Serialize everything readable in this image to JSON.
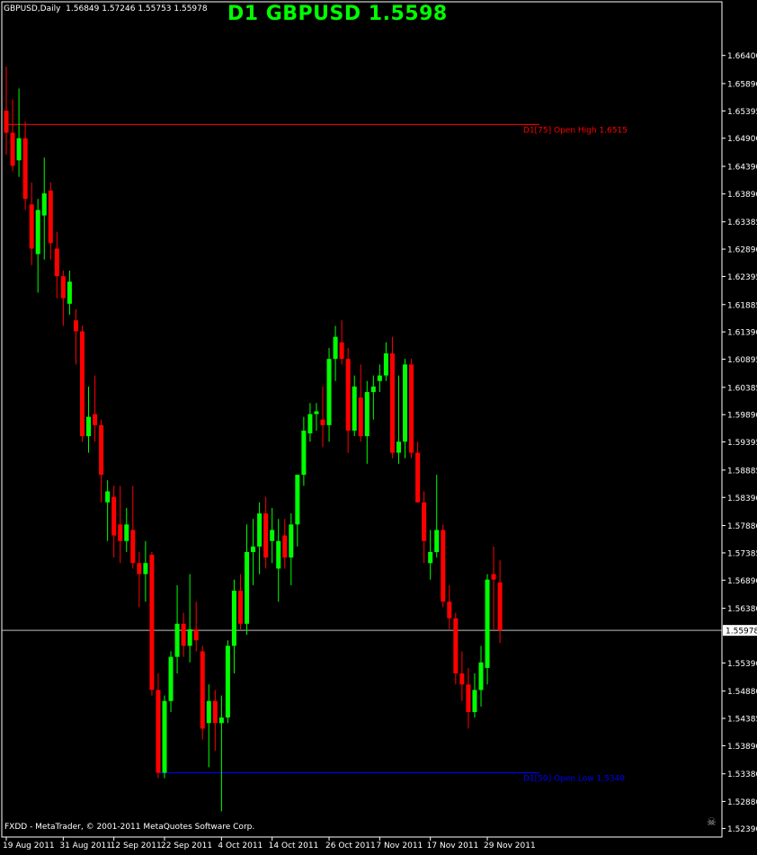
{
  "header": {
    "info": "GBPUSD,Daily  1.56849 1.57246 1.55753 1.55978",
    "title": "D1 GBPUSD 1.5598"
  },
  "footer": {
    "copyright": "FXDD - MetaTrader, © 2001-2011 MetaQuotes Software Corp."
  },
  "colors": {
    "bull": "#00ff00",
    "bear": "#ff0000",
    "grid": "#ffffff",
    "high_line": "#ff0000",
    "low_line": "#0000ff"
  },
  "icons": {
    "corner": "skull-icon"
  },
  "chart_data": {
    "type": "candlestick",
    "symbol": "GBPUSD",
    "timeframe": "Daily",
    "ylim": [
      1.523,
      1.669
    ],
    "price_ticks": [
      "1.66400",
      "1.65890",
      "1.65395",
      "1.64900",
      "1.64390",
      "1.63890",
      "1.63385",
      "1.62890",
      "1.62395",
      "1.61885",
      "1.61390",
      "1.60895",
      "1.60385",
      "1.59890",
      "1.59395",
      "1.58885",
      "1.58390",
      "1.57880",
      "1.57385",
      "1.56890",
      "1.56380",
      "1.55978",
      "1.55390",
      "1.54880",
      "1.54385",
      "1.53890",
      "1.53380",
      "1.52880",
      "1.52390"
    ],
    "date_ticks": [
      {
        "label": "19 Aug 2011",
        "index": 0
      },
      {
        "label": "31 Aug 2011",
        "index": 9
      },
      {
        "label": "12 Sep 2011",
        "index": 17
      },
      {
        "label": "22 Sep 2011",
        "index": 25
      },
      {
        "label": "4 Oct 2011",
        "index": 34
      },
      {
        "label": "14 Oct 2011",
        "index": 42
      },
      {
        "label": "26 Oct 2011",
        "index": 51
      },
      {
        "label": "7 Nov 2011",
        "index": 59
      },
      {
        "label": "17 Nov 2011",
        "index": 67
      },
      {
        "label": "29 Nov 2011",
        "index": 76
      }
    ],
    "current_price": {
      "value": 1.5598,
      "label": "1.55978"
    },
    "levels": [
      {
        "name": "open-high",
        "value": 1.6515,
        "label": "D1[75] Open High 1.6515",
        "color": "#ff0000"
      },
      {
        "name": "open-low",
        "value": 1.534,
        "label": "D1[50] Open Low 1.5340",
        "color": "#0000ff"
      }
    ],
    "candles": [
      {
        "o": 1.654,
        "h": 1.662,
        "l": 1.646,
        "c": 1.65
      },
      {
        "o": 1.65,
        "h": 1.656,
        "l": 1.643,
        "c": 1.644
      },
      {
        "o": 1.645,
        "h": 1.658,
        "l": 1.642,
        "c": 1.649
      },
      {
        "o": 1.649,
        "h": 1.652,
        "l": 1.636,
        "c": 1.638
      },
      {
        "o": 1.637,
        "h": 1.641,
        "l": 1.626,
        "c": 1.629
      },
      {
        "o": 1.628,
        "h": 1.638,
        "l": 1.621,
        "c": 1.636
      },
      {
        "o": 1.635,
        "h": 1.6455,
        "l": 1.627,
        "c": 1.639
      },
      {
        "o": 1.6395,
        "h": 1.641,
        "l": 1.627,
        "c": 1.63
      },
      {
        "o": 1.629,
        "h": 1.632,
        "l": 1.62,
        "c": 1.624
      },
      {
        "o": 1.624,
        "h": 1.625,
        "l": 1.615,
        "c": 1.62
      },
      {
        "o": 1.619,
        "h": 1.625,
        "l": 1.617,
        "c": 1.623
      },
      {
        "o": 1.616,
        "h": 1.618,
        "l": 1.608,
        "c": 1.614
      },
      {
        "o": 1.614,
        "h": 1.615,
        "l": 1.594,
        "c": 1.595
      },
      {
        "o": 1.595,
        "h": 1.604,
        "l": 1.592,
        "c": 1.5985
      },
      {
        "o": 1.599,
        "h": 1.606,
        "l": 1.594,
        "c": 1.597
      },
      {
        "o": 1.597,
        "h": 1.598,
        "l": 1.583,
        "c": 1.588
      },
      {
        "o": 1.583,
        "h": 1.587,
        "l": 1.576,
        "c": 1.585
      },
      {
        "o": 1.584,
        "h": 1.586,
        "l": 1.573,
        "c": 1.577
      },
      {
        "o": 1.579,
        "h": 1.586,
        "l": 1.572,
        "c": 1.576
      },
      {
        "o": 1.576,
        "h": 1.582,
        "l": 1.574,
        "c": 1.579
      },
      {
        "o": 1.578,
        "h": 1.586,
        "l": 1.571,
        "c": 1.572
      },
      {
        "o": 1.572,
        "h": 1.574,
        "l": 1.564,
        "c": 1.57
      },
      {
        "o": 1.57,
        "h": 1.576,
        "l": 1.565,
        "c": 1.572
      },
      {
        "o": 1.5735,
        "h": 1.574,
        "l": 1.548,
        "c": 1.549
      },
      {
        "o": 1.549,
        "h": 1.552,
        "l": 1.533,
        "c": 1.534
      },
      {
        "o": 1.534,
        "h": 1.548,
        "l": 1.533,
        "c": 1.547
      },
      {
        "o": 1.547,
        "h": 1.556,
        "l": 1.545,
        "c": 1.555
      },
      {
        "o": 1.555,
        "h": 1.568,
        "l": 1.552,
        "c": 1.561
      },
      {
        "o": 1.561,
        "h": 1.563,
        "l": 1.555,
        "c": 1.557
      },
      {
        "o": 1.557,
        "h": 1.57,
        "l": 1.554,
        "c": 1.56
      },
      {
        "o": 1.56,
        "h": 1.565,
        "l": 1.556,
        "c": 1.558
      },
      {
        "o": 1.556,
        "h": 1.557,
        "l": 1.54,
        "c": 1.542
      },
      {
        "o": 1.543,
        "h": 1.55,
        "l": 1.535,
        "c": 1.547
      },
      {
        "o": 1.547,
        "h": 1.549,
        "l": 1.538,
        "c": 1.543
      },
      {
        "o": 1.543,
        "h": 1.548,
        "l": 1.527,
        "c": 1.544
      },
      {
        "o": 1.544,
        "h": 1.558,
        "l": 1.543,
        "c": 1.557
      },
      {
        "o": 1.557,
        "h": 1.569,
        "l": 1.552,
        "c": 1.567
      },
      {
        "o": 1.567,
        "h": 1.57,
        "l": 1.56,
        "c": 1.561
      },
      {
        "o": 1.561,
        "h": 1.579,
        "l": 1.559,
        "c": 1.574
      },
      {
        "o": 1.574,
        "h": 1.58,
        "l": 1.568,
        "c": 1.575
      },
      {
        "o": 1.575,
        "h": 1.583,
        "l": 1.57,
        "c": 1.581
      },
      {
        "o": 1.581,
        "h": 1.584,
        "l": 1.571,
        "c": 1.573
      },
      {
        "o": 1.576,
        "h": 1.582,
        "l": 1.572,
        "c": 1.578
      },
      {
        "o": 1.571,
        "h": 1.58,
        "l": 1.565,
        "c": 1.576
      },
      {
        "o": 1.577,
        "h": 1.58,
        "l": 1.571,
        "c": 1.573
      },
      {
        "o": 1.573,
        "h": 1.581,
        "l": 1.568,
        "c": 1.579
      },
      {
        "o": 1.579,
        "h": 1.588,
        "l": 1.575,
        "c": 1.588
      },
      {
        "o": 1.588,
        "h": 1.5985,
        "l": 1.586,
        "c": 1.596
      },
      {
        "o": 1.5955,
        "h": 1.601,
        "l": 1.594,
        "c": 1.599
      },
      {
        "o": 1.599,
        "h": 1.601,
        "l": 1.596,
        "c": 1.5995
      },
      {
        "o": 1.598,
        "h": 1.604,
        "l": 1.593,
        "c": 1.597
      },
      {
        "o": 1.597,
        "h": 1.611,
        "l": 1.594,
        "c": 1.609
      },
      {
        "o": 1.609,
        "h": 1.615,
        "l": 1.605,
        "c": 1.613
      },
      {
        "o": 1.612,
        "h": 1.616,
        "l": 1.608,
        "c": 1.609
      },
      {
        "o": 1.609,
        "h": 1.611,
        "l": 1.592,
        "c": 1.596
      },
      {
        "o": 1.596,
        "h": 1.606,
        "l": 1.595,
        "c": 1.604
      },
      {
        "o": 1.602,
        "h": 1.608,
        "l": 1.594,
        "c": 1.595
      },
      {
        "o": 1.595,
        "h": 1.605,
        "l": 1.59,
        "c": 1.603
      },
      {
        "o": 1.603,
        "h": 1.606,
        "l": 1.598,
        "c": 1.604
      },
      {
        "o": 1.605,
        "h": 1.608,
        "l": 1.603,
        "c": 1.606
      },
      {
        "o": 1.606,
        "h": 1.612,
        "l": 1.605,
        "c": 1.61
      },
      {
        "o": 1.61,
        "h": 1.613,
        "l": 1.591,
        "c": 1.592
      },
      {
        "o": 1.592,
        "h": 1.606,
        "l": 1.59,
        "c": 1.594
      },
      {
        "o": 1.594,
        "h": 1.609,
        "l": 1.591,
        "c": 1.608
      },
      {
        "o": 1.608,
        "h": 1.609,
        "l": 1.591,
        "c": 1.592
      },
      {
        "o": 1.592,
        "h": 1.594,
        "l": 1.583,
        "c": 1.583
      },
      {
        "o": 1.583,
        "h": 1.585,
        "l": 1.572,
        "c": 1.576
      },
      {
        "o": 1.572,
        "h": 1.578,
        "l": 1.569,
        "c": 1.574
      },
      {
        "o": 1.574,
        "h": 1.588,
        "l": 1.573,
        "c": 1.578
      },
      {
        "o": 1.578,
        "h": 1.579,
        "l": 1.564,
        "c": 1.565
      },
      {
        "o": 1.565,
        "h": 1.568,
        "l": 1.56,
        "c": 1.562
      },
      {
        "o": 1.562,
        "h": 1.563,
        "l": 1.55,
        "c": 1.552
      },
      {
        "o": 1.552,
        "h": 1.556,
        "l": 1.547,
        "c": 1.55
      },
      {
        "o": 1.55,
        "h": 1.553,
        "l": 1.542,
        "c": 1.545
      },
      {
        "o": 1.545,
        "h": 1.552,
        "l": 1.544,
        "c": 1.549
      },
      {
        "o": 1.549,
        "h": 1.557,
        "l": 1.546,
        "c": 1.554
      },
      {
        "o": 1.553,
        "h": 1.57,
        "l": 1.55,
        "c": 1.569
      },
      {
        "o": 1.57,
        "h": 1.575,
        "l": 1.56,
        "c": 1.569
      },
      {
        "o": 1.5685,
        "h": 1.5725,
        "l": 1.5575,
        "c": 1.5598
      }
    ]
  }
}
